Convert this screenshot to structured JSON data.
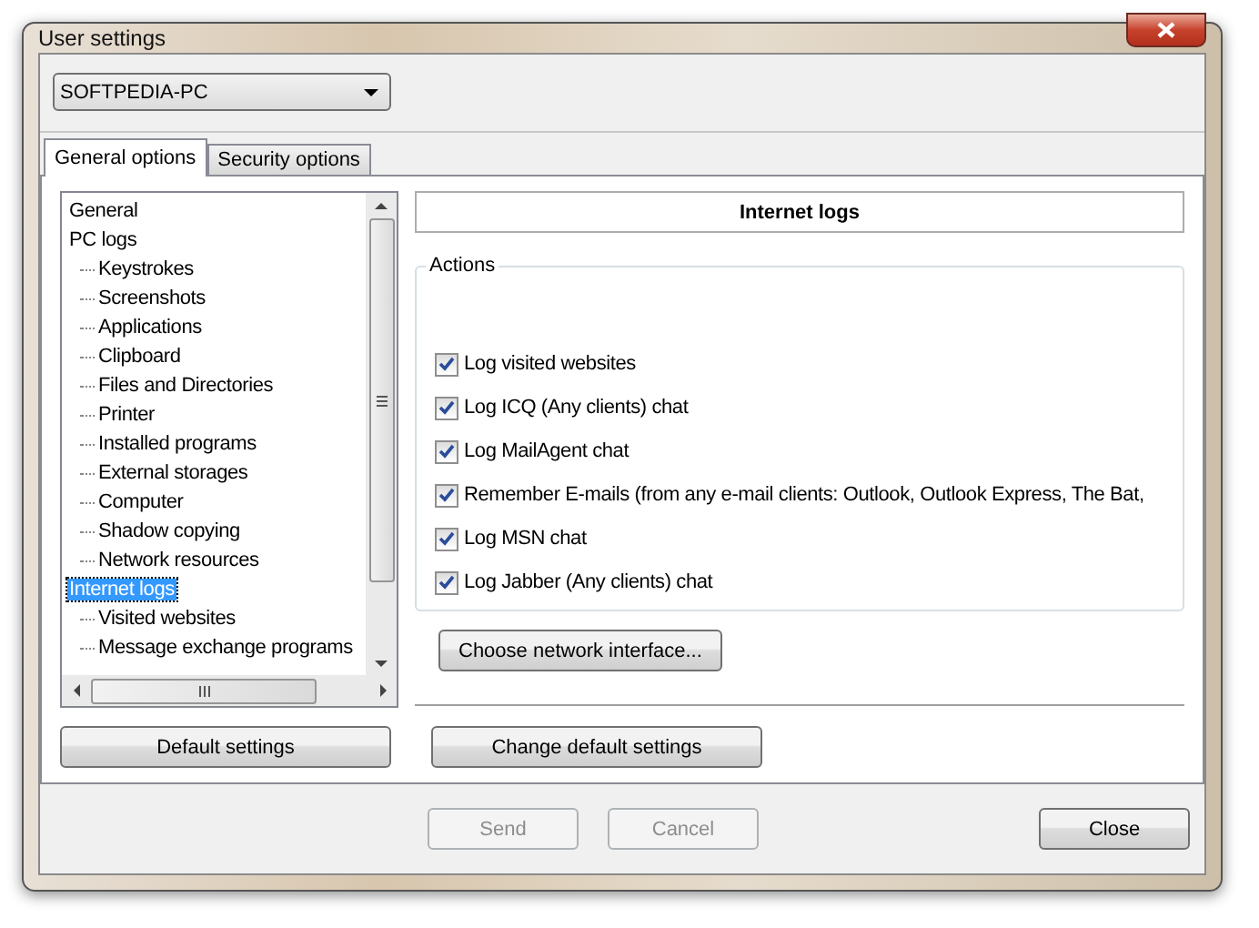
{
  "window": {
    "title": "User settings"
  },
  "computer_select": {
    "value": "SOFTPEDIA-PC"
  },
  "tabs": [
    {
      "label": "General options",
      "selected": true
    },
    {
      "label": "Security options",
      "selected": false
    }
  ],
  "tree": {
    "items": [
      {
        "label": "General",
        "selected": false
      },
      {
        "label": "PC logs",
        "selected": false,
        "children": [
          {
            "label": "Keystrokes",
            "selected": false
          },
          {
            "label": "Screenshots",
            "selected": false
          },
          {
            "label": "Applications",
            "selected": false
          },
          {
            "label": "Clipboard",
            "selected": false
          },
          {
            "label": "Files and Directories",
            "selected": false
          },
          {
            "label": "Printer",
            "selected": false
          },
          {
            "label": "Installed programs",
            "selected": false
          },
          {
            "label": "External storages",
            "selected": false
          },
          {
            "label": "Computer",
            "selected": false
          },
          {
            "label": "Shadow copying",
            "selected": false
          },
          {
            "label": "Network resources",
            "selected": false
          }
        ]
      },
      {
        "label": "Internet logs",
        "selected": true,
        "children": [
          {
            "label": "Visited websites",
            "selected": false
          },
          {
            "label": "Message exchange programs",
            "selected": false
          }
        ]
      }
    ]
  },
  "panel": {
    "title": "Internet logs"
  },
  "actions": {
    "label": "Actions",
    "options": [
      {
        "label": "Log visited websites",
        "checked": true
      },
      {
        "label": "Log ICQ (Any clients) chat",
        "checked": true
      },
      {
        "label": "Log MailAgent chat",
        "checked": true
      },
      {
        "label": "Remember E-mails (from any e-mail clients: Outlook, Outlook Express, The Bat,",
        "checked": true
      },
      {
        "label": "Log MSN chat",
        "checked": true
      },
      {
        "label": "Log Jabber (Any clients) chat",
        "checked": true
      }
    ]
  },
  "choose_button": {
    "label": "Choose network interface..."
  },
  "default_button": {
    "label": "Default settings"
  },
  "change_default_button": {
    "label": "Change default settings"
  },
  "footer_buttons": [
    {
      "label": "Send",
      "disabled": true
    },
    {
      "label": "Cancel",
      "disabled": true
    },
    {
      "label": "Close",
      "disabled": false
    }
  ]
}
